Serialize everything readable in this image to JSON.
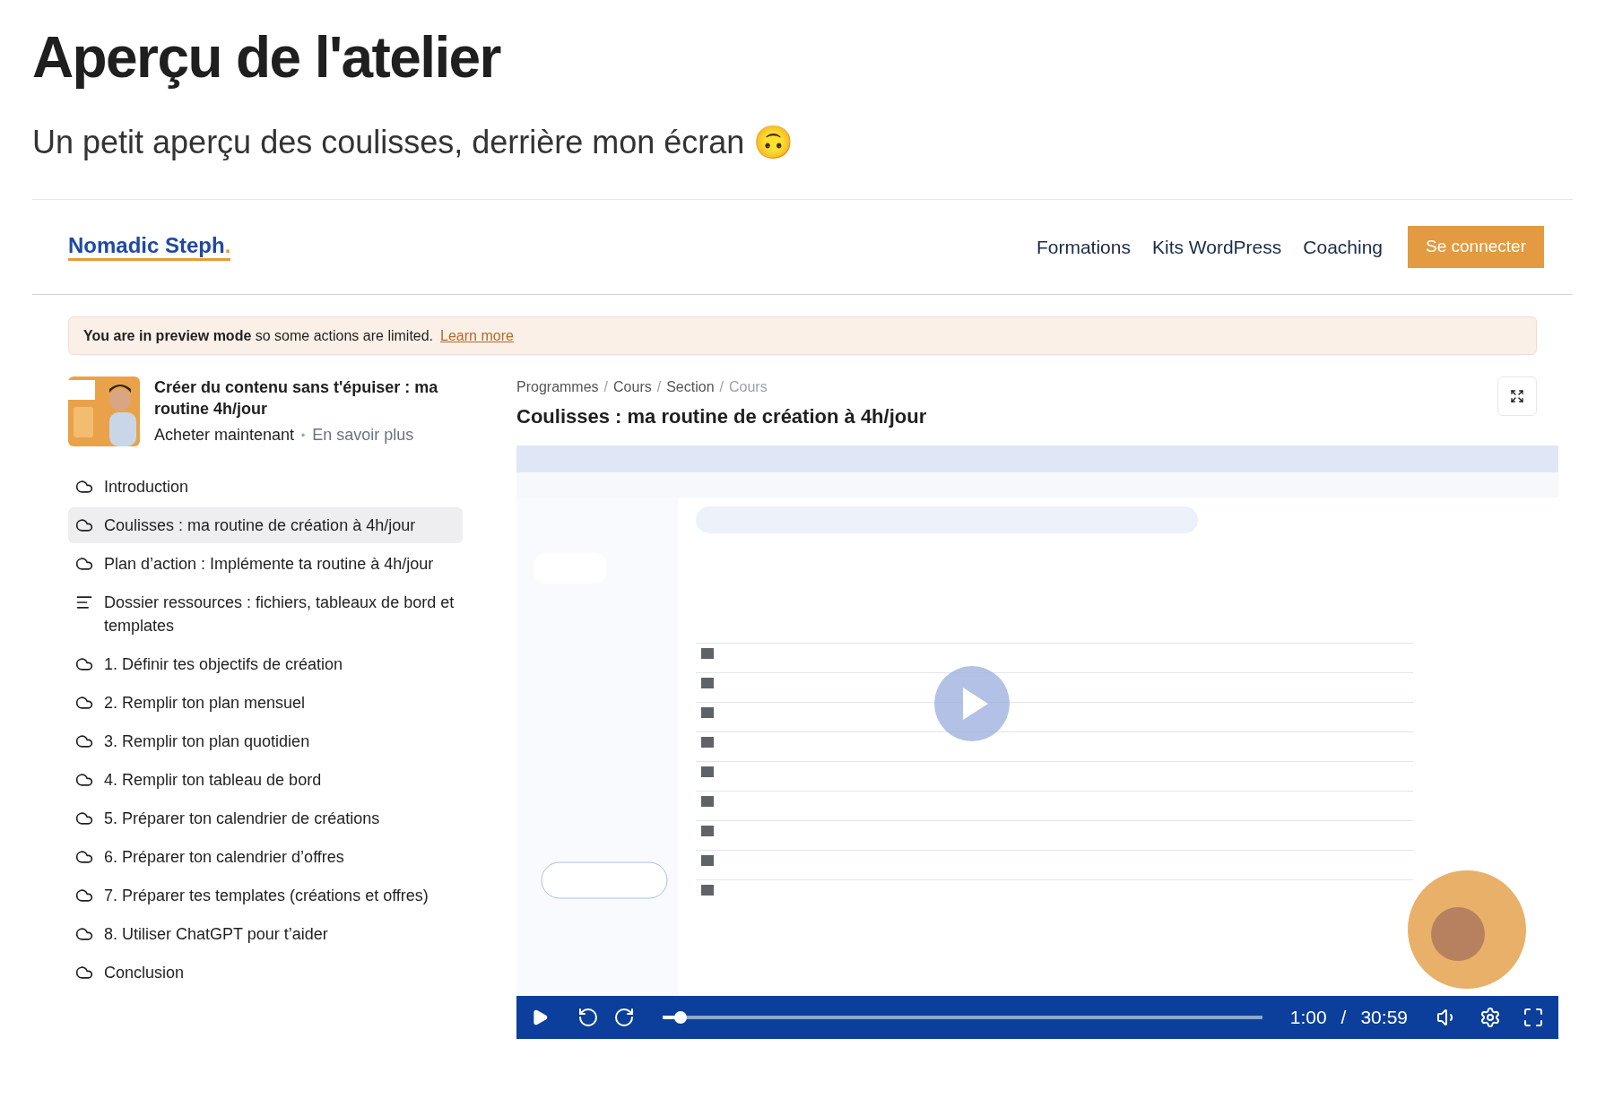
{
  "page": {
    "title": "Aperçu de l'atelier",
    "subtitle": "Un petit aperçu des coulisses, derrière mon écran 🙃"
  },
  "header": {
    "logo": "Nomadic Steph",
    "logo_dot": ".",
    "nav": [
      "Formations",
      "Kits WordPress",
      "Coaching"
    ],
    "login_button": "Se connecter"
  },
  "notice": {
    "text": "**You are in preview mode** so some actions are limited.",
    "link": "Learn more"
  },
  "course": {
    "title": "Créer du contenu sans t'épuiser : ma routine 4h/jour",
    "buy": "Acheter maintenant",
    "separator": "•",
    "more": "En savoir plus"
  },
  "lessons": [
    {
      "kind": "video",
      "label": "Introduction",
      "selected": false
    },
    {
      "kind": "video",
      "label": "Coulisses : ma routine de création à 4h/jour",
      "selected": true
    },
    {
      "kind": "video",
      "label": "Plan d’action : Implémente ta routine à 4h/jour",
      "selected": false
    },
    {
      "kind": "text",
      "label": "Dossier ressources : fichiers, tableaux de bord et templates",
      "selected": false
    },
    {
      "kind": "video",
      "label": "1. Définir tes objectifs de création",
      "selected": false
    },
    {
      "kind": "video",
      "label": "2. Remplir ton plan mensuel",
      "selected": false
    },
    {
      "kind": "video",
      "label": "3. Remplir ton plan quotidien",
      "selected": false
    },
    {
      "kind": "video",
      "label": "4. Remplir ton tableau de bord",
      "selected": false
    },
    {
      "kind": "video",
      "label": "5. Préparer ton calendrier de créations",
      "selected": false
    },
    {
      "kind": "video",
      "label": "6. Préparer ton calendrier d’offres",
      "selected": false
    },
    {
      "kind": "video",
      "label": "7. Préparer tes templates (créations et offres)",
      "selected": false
    },
    {
      "kind": "video",
      "label": "8. Utiliser ChatGPT pour t’aider",
      "selected": false
    },
    {
      "kind": "video",
      "label": "Conclusion",
      "selected": false
    }
  ],
  "breadcrumb": [
    {
      "label": "Programmes",
      "current": false
    },
    {
      "label": "Cours",
      "current": false
    },
    {
      "label": "Section",
      "current": false
    },
    {
      "label": "Cours",
      "current": true
    }
  ],
  "breadcrumb_separator": "/",
  "lesson_title": "Coulisses : ma routine de création à 4h/jour",
  "video": {
    "level": 0.03,
    "current_time": "1:00",
    "time_separator": "/",
    "duration": "30:59"
  }
}
